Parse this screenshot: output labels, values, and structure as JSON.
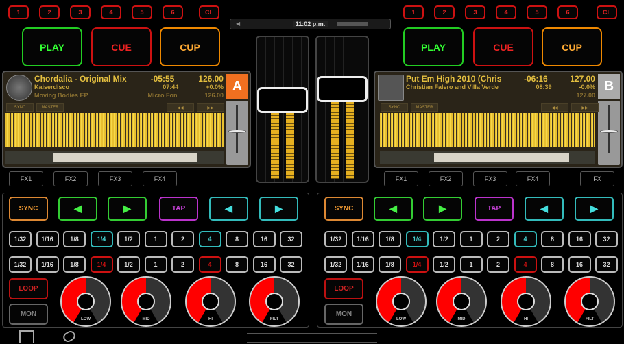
{
  "colors": {
    "accent_orange": "#f07020",
    "waveform": "#e8c030",
    "play": "#33cc33",
    "cue": "#cc1111",
    "cup": "#ee8800",
    "tap": "#bb33cc",
    "nudge": "#33bbbb"
  },
  "status_bar": {
    "time": "11:02 p.m."
  },
  "hotcues": [
    "1",
    "2",
    "3",
    "4",
    "5",
    "6"
  ],
  "clear_label": "CL",
  "transport": {
    "play": "PLAY",
    "cue": "CUE",
    "cup": "CUP"
  },
  "deckA": {
    "letter": "A",
    "title": "Chordalia - Original Mix",
    "remaining": "-05:55",
    "bpm": "126.00",
    "artist": "Kaiserdisco",
    "elapsed": "07:44",
    "pitch": "+0.0%",
    "album": "Moving Bodies EP",
    "label": "Micro Fon",
    "base_bpm": "126.00",
    "sync": "SYNC",
    "master": "MASTER",
    "channel_fader": 0.58,
    "meter_level": 0.5
  },
  "deckB": {
    "letter": "B",
    "title": "Put Em High 2010 (Chris",
    "remaining": "-06:16",
    "bpm": "127.00",
    "artist": "Christian Falero and Villa Verde",
    "elapsed": "08:39",
    "pitch": "-0.0%",
    "album": "",
    "label": "",
    "base_bpm": "127.00",
    "sync": "SYNC",
    "master": "MASTER",
    "channel_fader": 0.67,
    "meter_level": 0.58
  },
  "fx_left": [
    "FX1",
    "FX2",
    "FX3",
    "FX4"
  ],
  "fx_right": [
    "FX1",
    "FX2",
    "FX3",
    "FX4",
    "FX"
  ],
  "controls": {
    "sync": "SYNC",
    "tap": "TAP",
    "loop": "LOOP",
    "mon": "MON",
    "prev": "◀",
    "next": "▶"
  },
  "loop_sizes": [
    "1/32",
    "1/16",
    "1/8",
    "1/4",
    "1/2",
    "1",
    "2",
    "4",
    "8",
    "16",
    "32"
  ],
  "row1_selected": [
    "1/4",
    "4"
  ],
  "row2_selected": [
    "1/4",
    "4"
  ],
  "eq": [
    {
      "label": "LOW",
      "value": 0.5
    },
    {
      "label": "MID",
      "value": 0.5
    },
    {
      "label": "HI",
      "value": 0.5
    },
    {
      "label": "FILT",
      "value": 0.5
    }
  ]
}
